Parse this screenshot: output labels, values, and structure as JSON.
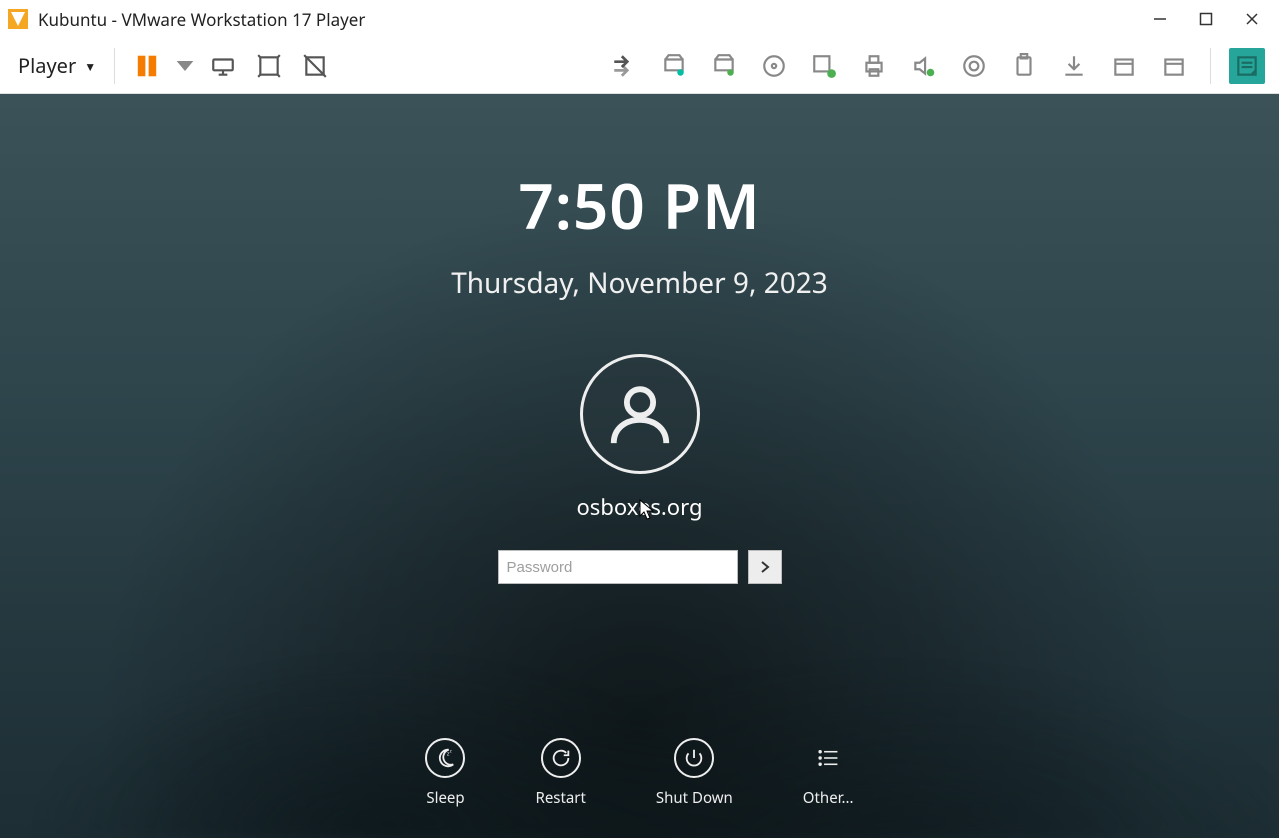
{
  "titlebar": {
    "title": "Kubuntu - VMware Workstation 17 Player"
  },
  "toolbar": {
    "player_label": "Player"
  },
  "lockscreen": {
    "time": "7:50 PM",
    "date": "Thursday, November 9, 2023",
    "username": "osboxes.org",
    "password_placeholder": "Password",
    "power": {
      "sleep": "Sleep",
      "restart": "Restart",
      "shutdown": "Shut Down",
      "other": "Other..."
    }
  }
}
